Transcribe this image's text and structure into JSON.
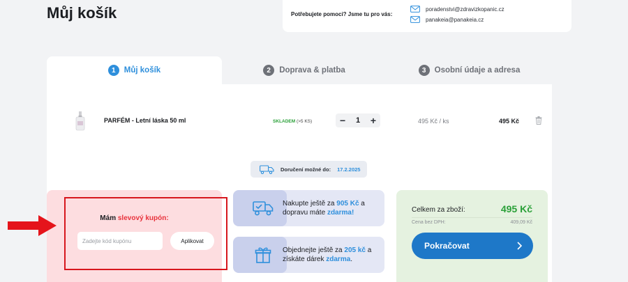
{
  "page": {
    "title": "Můj košík"
  },
  "help": {
    "label": "Potřebujete pomoci? Jsme tu pro vás:",
    "contacts": [
      {
        "email": "poradenstvi@zdravizkopanic.cz",
        "icon": "mail-icon"
      },
      {
        "email": "panakeia@panakeia.cz",
        "icon": "mail-icon"
      }
    ]
  },
  "steps": [
    {
      "number": "1",
      "label": "Můj košík",
      "active": true
    },
    {
      "number": "2",
      "label": "Doprava & platba",
      "active": false
    },
    {
      "number": "3",
      "label": "Osobní údaje a adresa",
      "active": false
    }
  ],
  "cart": {
    "items": [
      {
        "name": "PARFÉM - Letní láska 50 ml",
        "stock": "SKLADEM",
        "stock_count": "(>5 KS)",
        "qty": "1",
        "minus": "−",
        "plus": "+",
        "unit_price": "495 Kč  / ks",
        "total": "495 Kč"
      }
    ]
  },
  "delivery": {
    "label": "Doručení možné do:",
    "date": "17.2.2025"
  },
  "coupon": {
    "title_prefix": "Mám",
    "title_accent": "slevový kupón:",
    "placeholder": "Zadejte kód kupónu",
    "apply_label": "Aplikovat"
  },
  "promos": [
    {
      "icon": "delivery-truck-icon",
      "t1": "Nakupte ještě za ",
      "hl1": "905 Kč",
      "t2": " a dopravu máte ",
      "hl2": "zdarma!",
      "t3": ""
    },
    {
      "icon": "gift-icon",
      "t1": "Objednejte ještě za ",
      "hl1": "205 kč",
      "t2": " a získáte dárek ",
      "hl2": "zdarma",
      "t3": "."
    }
  ],
  "summary": {
    "total_label": "Celkem za zboží:",
    "total_value": "495 Kč",
    "vat_label": "Cena bez DPH:",
    "vat_value": "409,09 Kč",
    "continue_label": "Pokračovat"
  },
  "colors": {
    "accent": "#2e8fdc",
    "success": "#2aa038",
    "danger": "#e8323c",
    "annotation": "#d7161d"
  }
}
